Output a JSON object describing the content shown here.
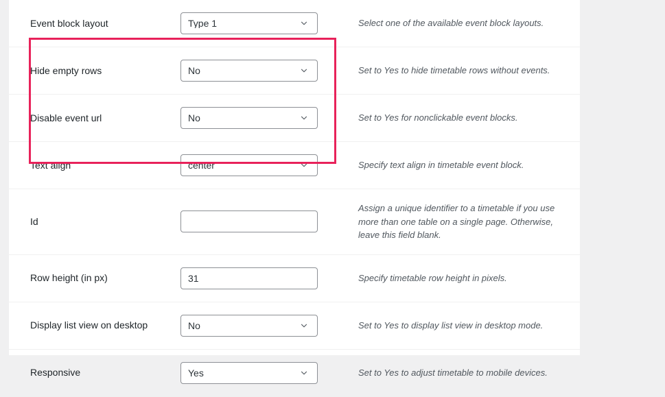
{
  "theme": {
    "page_background": "#f0f0f1",
    "panel_background": "#ffffff",
    "label_color": "#1d2327",
    "description_color": "#50575e",
    "control_border": "#8c8f94",
    "row_separator": "#f0f0f0",
    "highlight_border": "#e8225a"
  },
  "settings": {
    "rows": [
      {
        "label": "Event block layout",
        "control": "select",
        "value": "Type 1",
        "description": "Select one of the available event block layouts.",
        "highlighted": false
      },
      {
        "label": "Hide empty rows",
        "control": "select",
        "value": "No",
        "description": "Set to Yes to hide timetable rows without events.",
        "highlighted": true
      },
      {
        "label": "Disable event url",
        "control": "select",
        "value": "No",
        "description": "Set to Yes for nonclickable event blocks.",
        "highlighted": true
      },
      {
        "label": "Text align",
        "control": "select",
        "value": "center",
        "description": "Specify text align in timetable event block.",
        "highlighted": true
      },
      {
        "label": "Id",
        "control": "text",
        "value": "",
        "placeholder": "",
        "description": "Assign a unique identifier to a timetable if you use more than one table on a single page. Otherwise, leave this field blank.",
        "highlighted": false
      },
      {
        "label": "Row height (in px)",
        "control": "text",
        "value": "31",
        "placeholder": "",
        "description": "Specify timetable row height in pixels.",
        "highlighted": false
      },
      {
        "label": "Display list view on desktop",
        "control": "select",
        "value": "No",
        "description": "Set to Yes to display list view in desktop mode.",
        "highlighted": false
      },
      {
        "label": "Responsive",
        "control": "select",
        "value": "Yes",
        "description": "Set to Yes to adjust timetable to mobile devices.",
        "highlighted": false
      }
    ]
  },
  "icons": {
    "dropdown": "chevron-down-icon"
  }
}
